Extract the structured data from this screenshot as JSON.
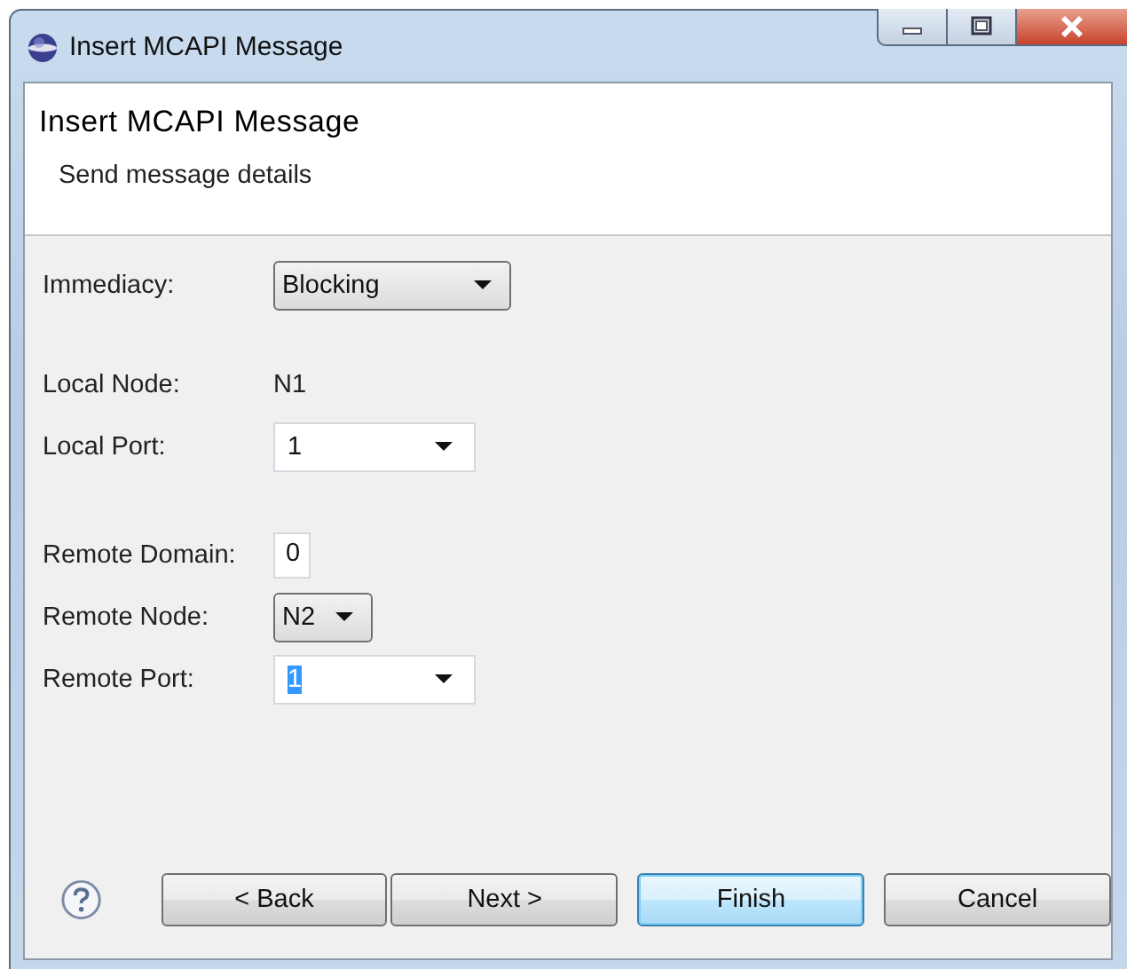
{
  "window": {
    "title": "Insert MCAPI Message"
  },
  "header": {
    "title": "Insert MCAPI Message",
    "description": "Send message details"
  },
  "groups": [
    {
      "fields": [
        {
          "label": "Immediacy:",
          "kind": "combo",
          "value": "Blocking",
          "wide": true
        }
      ]
    },
    {
      "fields": [
        {
          "label": "Local Node:",
          "kind": "readonly",
          "value": "N1"
        },
        {
          "label": "Local Port:",
          "kind": "dropdown",
          "value": "1",
          "text_selected": false
        }
      ]
    },
    {
      "fields": [
        {
          "label": "Remote Domain:",
          "kind": "text",
          "value": "0"
        },
        {
          "label": "Remote Node:",
          "kind": "combo",
          "value": "N2",
          "wide": false
        },
        {
          "label": "Remote Port:",
          "kind": "dropdown",
          "value": "1",
          "text_selected": true
        }
      ]
    }
  ],
  "buttons": [
    {
      "label": "< Back",
      "default": false
    },
    {
      "label": "Next >",
      "default": false
    },
    {
      "label": "Finish",
      "default": true
    },
    {
      "label": "Cancel",
      "default": false
    }
  ]
}
